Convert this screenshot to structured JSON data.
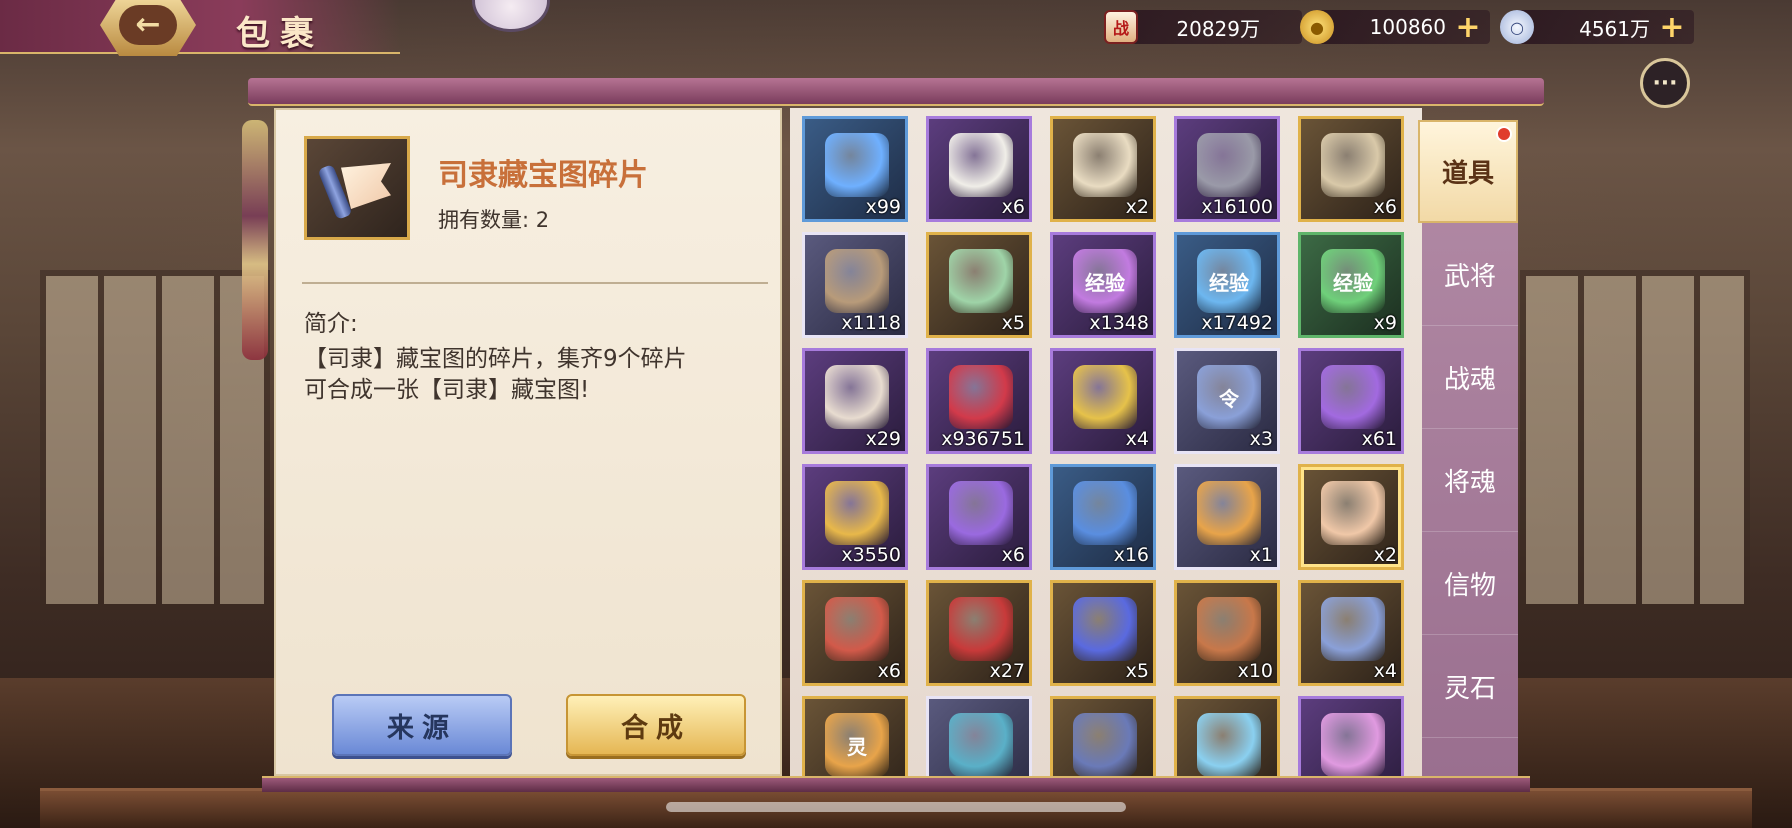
{
  "header": {
    "title": "包裹",
    "back_icon": "back-arrow-icon"
  },
  "resources": [
    {
      "name": "battle-power",
      "icon": "战",
      "value": "20829万",
      "has_plus": false
    },
    {
      "name": "gold-ingot",
      "icon": "",
      "value": "100860",
      "has_plus": true
    },
    {
      "name": "silver-coin",
      "icon": "",
      "value": "4561万",
      "has_plus": true
    }
  ],
  "detail": {
    "name": "司隶藏宝图碎片",
    "count_text": "拥有数量: 2",
    "desc_title": "简介:",
    "desc_line1": "【司隶】藏宝图的碎片，集齐9个碎片",
    "desc_line2": "可合成一张【司隶】藏宝图!",
    "btn_source": "来源",
    "btn_compose": "合成"
  },
  "tabs": [
    {
      "label": "道具",
      "active": true,
      "badge": true
    },
    {
      "label": "武将",
      "active": false,
      "badge": false
    },
    {
      "label": "战魂",
      "active": false,
      "badge": false
    },
    {
      "label": "将魂",
      "active": false,
      "badge": false
    },
    {
      "label": "信物",
      "active": false,
      "badge": false
    },
    {
      "label": "灵石",
      "active": false,
      "badge": false
    }
  ],
  "items": [
    {
      "quality": "blue",
      "qty": "x99",
      "icon": "blue-flame-icon",
      "color": "#6fb0ff",
      "glyph": ""
    },
    {
      "quality": "purple",
      "qty": "x6",
      "icon": "steamed-bun-icon",
      "color": "#f0eee8",
      "glyph": ""
    },
    {
      "quality": "gold",
      "qty": "x2",
      "icon": "map-scroll-icon",
      "color": "#e9dcc2",
      "glyph": ""
    },
    {
      "quality": "purple",
      "qty": "x16100",
      "icon": "stone-tablet-icon",
      "color": "#9a9aa8",
      "glyph": ""
    },
    {
      "quality": "gold",
      "qty": "x6",
      "icon": "painting-scroll-icon",
      "color": "#d9c9a9",
      "glyph": ""
    },
    {
      "quality": "white",
      "qty": "x1118",
      "icon": "wood-log-icon",
      "color": "#b89b7a",
      "glyph": ""
    },
    {
      "quality": "gold",
      "qty": "x5",
      "icon": "jade-scroll-icon",
      "color": "#9fd4a8",
      "glyph": ""
    },
    {
      "quality": "purple",
      "qty": "x1348",
      "icon": "exp-orb-purple-icon",
      "color": "#c27be0",
      "glyph": "经验"
    },
    {
      "quality": "blue",
      "qty": "x17492",
      "icon": "exp-orb-blue-icon",
      "color": "#6db7f0",
      "glyph": "经验"
    },
    {
      "quality": "green",
      "qty": "x9",
      "icon": "exp-orb-green-icon",
      "color": "#6fd07a",
      "glyph": "经验"
    },
    {
      "quality": "purple",
      "qty": "x29",
      "icon": "conch-horn-icon",
      "color": "#e8dcd0",
      "glyph": ""
    },
    {
      "quality": "purple",
      "qty": "x936751",
      "icon": "red-crystal-icon",
      "color": "#d23a4a",
      "glyph": ""
    },
    {
      "quality": "purple",
      "qty": "x4",
      "icon": "gold-bars-icon",
      "color": "#e6c24a",
      "glyph": ""
    },
    {
      "quality": "white",
      "qty": "x3",
      "icon": "token-plate-icon",
      "color": "#8aa0d8",
      "glyph": "令"
    },
    {
      "quality": "purple",
      "qty": "x61",
      "icon": "purple-talisman-icon",
      "color": "#a26ae0",
      "glyph": ""
    },
    {
      "quality": "purple",
      "qty": "x3550",
      "icon": "gold-ring-icon",
      "color": "#e8b84a",
      "glyph": ""
    },
    {
      "quality": "purple",
      "qty": "x6",
      "icon": "purple-gem-icon",
      "color": "#9a6ae0",
      "glyph": ""
    },
    {
      "quality": "blue",
      "qty": "x16",
      "icon": "blue-gem-icon",
      "color": "#5a8ee0",
      "glyph": ""
    },
    {
      "quality": "white",
      "qty": "x1",
      "icon": "gold-fragment-icon",
      "color": "#e8a44a",
      "glyph": ""
    },
    {
      "quality": "gold",
      "qty": "x2",
      "icon": "map-fragment-icon",
      "color": "#f0c8a8",
      "glyph": "",
      "selected": true
    },
    {
      "quality": "gold",
      "qty": "x6",
      "icon": "map-fragment-red-icon",
      "color": "#d25a4a",
      "glyph": ""
    },
    {
      "quality": "gold",
      "qty": "x27",
      "icon": "red-scroll-icon",
      "color": "#c83a3a",
      "glyph": ""
    },
    {
      "quality": "gold",
      "qty": "x5",
      "icon": "armillary-orb-icon",
      "color": "#5a6ae0",
      "glyph": ""
    },
    {
      "quality": "gold",
      "qty": "x10",
      "icon": "bronze-fragment-icon",
      "color": "#c8784a",
      "glyph": ""
    },
    {
      "quality": "gold",
      "qty": "x4",
      "icon": "map-fragment-blue-icon",
      "color": "#8aa0d8",
      "glyph": ""
    },
    {
      "quality": "gold",
      "qty": "",
      "icon": "spirit-stone-icon",
      "color": "#e8a44a",
      "glyph": "灵"
    },
    {
      "quality": "white",
      "qty": "",
      "icon": "blue-vase-icon",
      "color": "#5ab0c8",
      "glyph": ""
    },
    {
      "quality": "gold",
      "qty": "",
      "icon": "dark-crystal-icon",
      "color": "#6a7ab8",
      "glyph": ""
    },
    {
      "quality": "gold",
      "qty": "",
      "icon": "ice-crystal-icon",
      "color": "#8ad0f0",
      "glyph": ""
    },
    {
      "quality": "purple",
      "qty": "",
      "icon": "powder-pile-icon",
      "color": "#e09ae0",
      "glyph": ""
    }
  ]
}
